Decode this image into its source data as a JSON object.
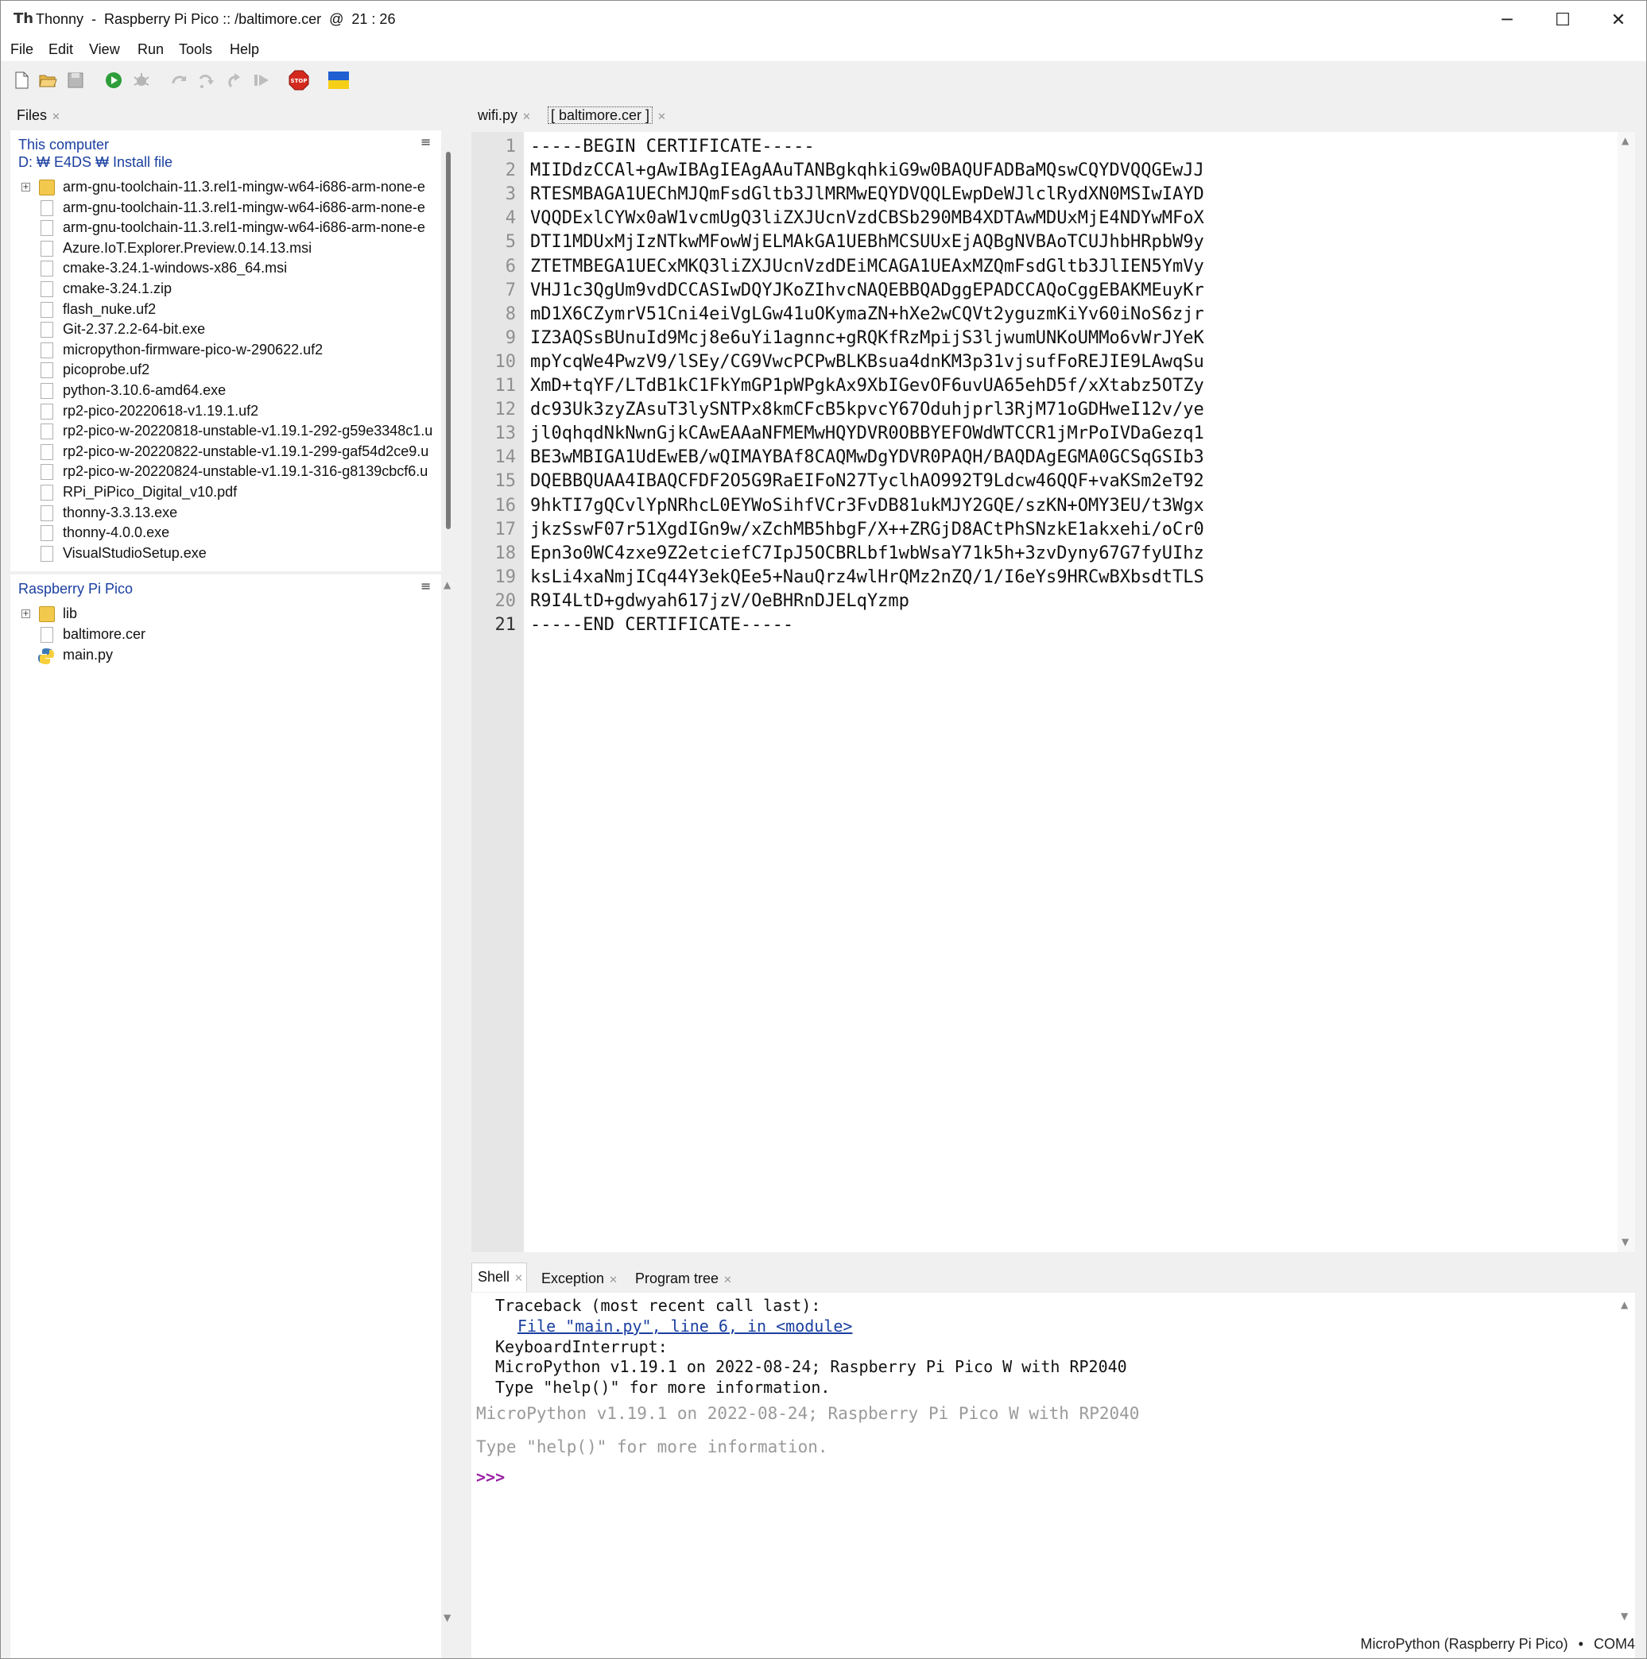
{
  "window": {
    "title": "Thonny  -  Raspberry Pi Pico :: /baltimore.cer  @  21 : 26",
    "controls": {
      "minimize": "─",
      "maximize": "☐",
      "close": "✕"
    }
  },
  "menu": [
    "File",
    "Edit",
    "View",
    "Run",
    "Tools",
    "Help"
  ],
  "toolbar": {
    "icons": [
      "new-file-icon",
      "open-folder-icon",
      "save-icon",
      "run-icon",
      "debug-icon",
      "step-over-icon",
      "step-into-icon",
      "step-out-icon",
      "resume-icon",
      "stop-icon",
      "ukraine-flag-icon"
    ],
    "stop_label": "STOP"
  },
  "files_panel": {
    "tab": "Files",
    "this_computer": {
      "title": "This computer",
      "path": "D: ₩ E4DS ₩ Install file",
      "items": [
        {
          "name": "arm-gnu-toolchain-11.3.rel1-mingw-w64-i686-arm-none-e",
          "type": "folder"
        },
        {
          "name": "arm-gnu-toolchain-11.3.rel1-mingw-w64-i686-arm-none-e",
          "type": "file"
        },
        {
          "name": "arm-gnu-toolchain-11.3.rel1-mingw-w64-i686-arm-none-e",
          "type": "file"
        },
        {
          "name": "Azure.IoT.Explorer.Preview.0.14.13.msi",
          "type": "file"
        },
        {
          "name": "cmake-3.24.1-windows-x86_64.msi",
          "type": "file"
        },
        {
          "name": "cmake-3.24.1.zip",
          "type": "file"
        },
        {
          "name": "flash_nuke.uf2",
          "type": "file"
        },
        {
          "name": "Git-2.37.2.2-64-bit.exe",
          "type": "file"
        },
        {
          "name": "micropython-firmware-pico-w-290622.uf2",
          "type": "file"
        },
        {
          "name": "picoprobe.uf2",
          "type": "file"
        },
        {
          "name": "python-3.10.6-amd64.exe",
          "type": "file"
        },
        {
          "name": "rp2-pico-20220618-v1.19.1.uf2",
          "type": "file"
        },
        {
          "name": "rp2-pico-w-20220818-unstable-v1.19.1-292-g59e3348c1.u",
          "type": "file"
        },
        {
          "name": "rp2-pico-w-20220822-unstable-v1.19.1-299-gaf54d2ce9.u",
          "type": "file"
        },
        {
          "name": "rp2-pico-w-20220824-unstable-v1.19.1-316-g8139cbcf6.u",
          "type": "file"
        },
        {
          "name": "RPi_PiPico_Digital_v10.pdf",
          "type": "file"
        },
        {
          "name": "thonny-3.3.13.exe",
          "type": "file"
        },
        {
          "name": "thonny-4.0.0.exe",
          "type": "file"
        },
        {
          "name": "VisualStudioSetup.exe",
          "type": "file"
        }
      ]
    },
    "pico": {
      "title": "Raspberry Pi Pico",
      "items": [
        {
          "name": "lib",
          "type": "folder"
        },
        {
          "name": "baltimore.cer",
          "type": "file"
        },
        {
          "name": "main.py",
          "type": "python"
        }
      ]
    }
  },
  "editor": {
    "tabs": [
      {
        "label": "wifi.py",
        "active": false
      },
      {
        "label": "[ baltimore.cer ]",
        "active": true
      }
    ],
    "current_line": 21,
    "lines": [
      "-----BEGIN CERTIFICATE-----",
      "MIIDdzCCAl+gAwIBAgIEAgAAuTANBgkqhkiG9w0BAQUFADBaMQswCQYDVQQGEwJJ",
      "RTESMBAGA1UEChMJQmFsdGltb3JlMRMwEQYDVQQLEwpDeWJlclRydXN0MSIwIAYD",
      "VQQDExlCYWx0aW1vcmUgQ3liZXJUcnVzdCBSb290MB4XDTAwMDUxMjE4NDYwMFoX",
      "DTI1MDUxMjIzNTkwMFowWjELMAkGA1UEBhMCSUUxEjAQBgNVBAoTCUJhbHRpbW9y",
      "ZTETMBEGA1UECxMKQ3liZXJUcnVzdDEiMCAGA1UEAxMZQmFsdGltb3JlIEN5YmVy",
      "VHJ1c3QgUm9vdDCCASIwDQYJKoZIhvcNAQEBBQADggEPADCCAQoCggEBAKMEuyKr",
      "mD1X6CZymrV51Cni4eiVgLGw41uOKymaZN+hXe2wCQVt2yguzmKiYv60iNoS6zjr",
      "IZ3AQSsBUnuId9Mcj8e6uYi1agnnc+gRQKfRzMpijS3ljwumUNKoUMMo6vWrJYeK",
      "mpYcqWe4PwzV9/lSEy/CG9VwcPCPwBLKBsua4dnKM3p31vjsufFoREJIE9LAwqSu",
      "XmD+tqYF/LTdB1kC1FkYmGP1pWPgkAx9XbIGevOF6uvUA65ehD5f/xXtabz5OTZy",
      "dc93Uk3zyZAsuT3lySNTPx8kmCFcB5kpvcY67Oduhjprl3RjM71oGDHweI12v/ye",
      "jl0qhqdNkNwnGjkCAwEAAaNFMEMwHQYDVR0OBBYEFOWdWTCCR1jMrPoIVDaGezq1",
      "BE3wMBIGA1UdEwEB/wQIMAYBAf8CAQMwDgYDVR0PAQH/BAQDAgEGMA0GCSqGSIb3",
      "DQEBBQUAA4IBAQCFDF2O5G9RaEIFoN27TyclhAO992T9Ldcw46QQF+vaKSm2eT92",
      "9hkTI7gQCvlYpNRhcL0EYWoSihfVCr3FvDB81ukMJY2GQE/szKN+OMY3EU/t3Wgx",
      "jkzSswF07r51XgdIGn9w/xZchMB5hbgF/X++ZRGjD8ACtPhSNzkE1akxehi/oCr0",
      "Epn3o0WC4zxe9Z2etciefC7IpJ5OCBRLbf1wbWsaY71k5h+3zvDyny67G7fyUIhz",
      "ksLi4xaNmjICq44Y3ekQEe5+NauQrz4wlHrQMz2nZQ/1/I6eYs9HRCwBXbsdtTLS",
      "R9I4LtD+gdwyah617jzV/OeBHRnDJELqYzmp",
      "-----END CERTIFICATE-----"
    ]
  },
  "bottom_tabs": [
    {
      "label": "Shell",
      "active": true
    },
    {
      "label": "Exception",
      "active": false
    },
    {
      "label": "Program tree",
      "active": false
    }
  ],
  "shell": {
    "traceback": "Traceback (most recent call last):",
    "traceback_link": "File \"main.py\", line 6, in <module>",
    "interrupt": "KeyboardInterrupt:",
    "banner1": "MicroPython v1.19.1 on 2022-08-24; Raspberry Pi Pico W with RP2040",
    "help1": "Type \"help()\" for more information.",
    "banner2": "MicroPython v1.19.1 on 2022-08-24; Raspberry Pi Pico W with RP2040",
    "help2": "Type \"help()\" for more information.",
    "prompt": ">>>"
  },
  "status_bar": {
    "interpreter": "MicroPython (Raspberry Pi Pico)",
    "separator": "•",
    "port": "COM4"
  },
  "colors": {
    "link": "#1a3fa0",
    "prompt": "#9a1fa5",
    "gutter": "#e6e6e6"
  }
}
